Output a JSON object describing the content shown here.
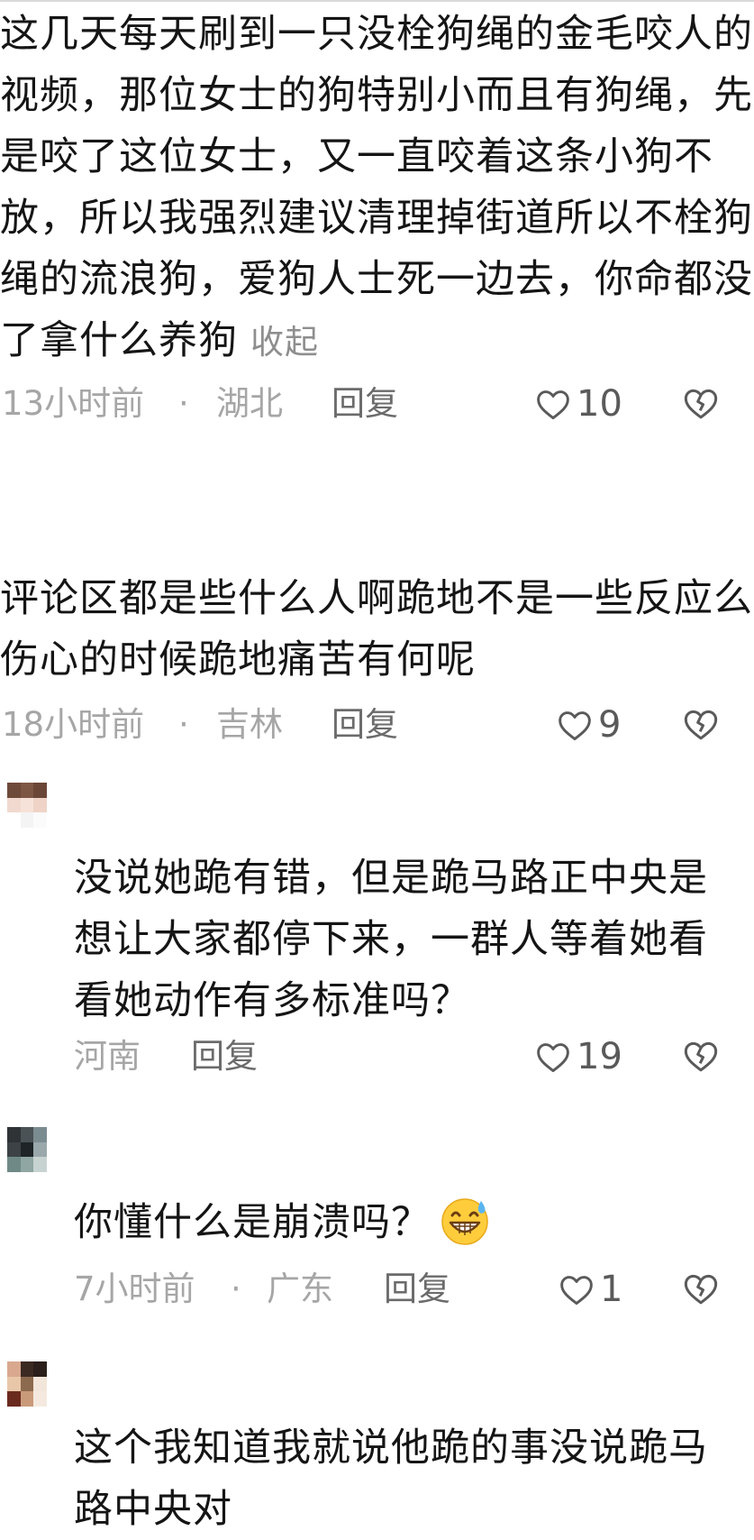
{
  "comments": [
    {
      "text": "这几天每天刷到一只没栓狗绳的金毛咬人的视频，那位女士的狗特别小而且有狗绳，先是咬了这位女士，又一直咬着这条小狗不放，所以我强烈建议清理掉街道所以不栓狗绳的流浪狗，爱狗人士死一边去，你命都没了拿什么养狗",
      "collapse_label": "收起",
      "time": "13小时前",
      "separator": "·",
      "region": "湖北",
      "reply_label": "回复",
      "likes": "10"
    },
    {
      "text": "评论区都是些什么人啊跪地不是一些反应么伤心的时候跪地痛苦有何呢",
      "time": "18小时前",
      "separator": "·",
      "region": "吉林",
      "reply_label": "回复",
      "likes": "9"
    }
  ],
  "replies": [
    {
      "text": "没说她跪有错，但是跪马路正中央是想让大家都停下来，一群人等着她看看她动作有多标准吗？",
      "region": "河南",
      "reply_label": "回复",
      "likes": "19"
    },
    {
      "text": "你懂什么是崩溃吗？",
      "emoji": "grinning-sweat-emoji",
      "time": "7小时前",
      "separator": "·",
      "region": "广东",
      "reply_label": "回复",
      "likes": "1"
    },
    {
      "text": "这个我知道我就说他跪的事没说跪马路中央对"
    }
  ],
  "colors": {
    "meta_gray": "#a6a6a6",
    "reply_link": "#6b6b6b",
    "text": "#151515"
  }
}
